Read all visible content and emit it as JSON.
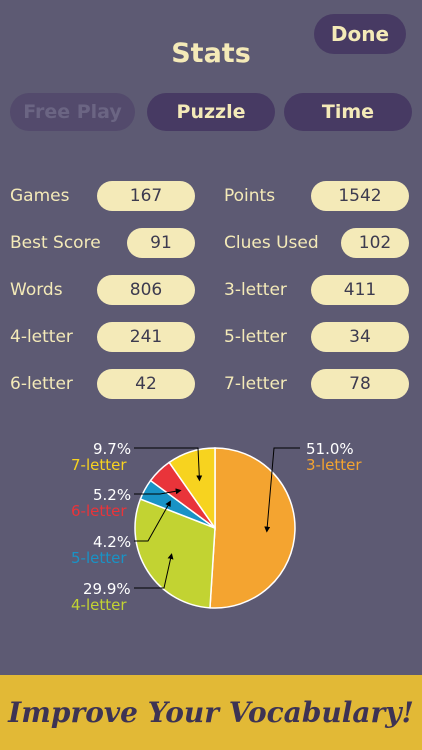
{
  "header": {
    "title": "Stats",
    "done_label": "Done"
  },
  "tabs": [
    {
      "label": "Free Play",
      "enabled": false
    },
    {
      "label": "Puzzle",
      "enabled": true
    },
    {
      "label": "Time",
      "enabled": true
    }
  ],
  "stats": {
    "games": {
      "label": "Games",
      "value": "167"
    },
    "points": {
      "label": "Points",
      "value": "1542"
    },
    "best_score": {
      "label": "Best Score",
      "value": "91"
    },
    "clues_used": {
      "label": "Clues Used",
      "value": "102"
    },
    "words": {
      "label": "Words",
      "value": "806"
    },
    "three_letter": {
      "label": "3-letter",
      "value": "411"
    },
    "four_letter": {
      "label": "4-letter",
      "value": "241"
    },
    "five_letter": {
      "label": "5-letter",
      "value": "34"
    },
    "six_letter": {
      "label": "6-letter",
      "value": "42"
    },
    "seven_letter": {
      "label": "7-letter",
      "value": "78"
    }
  },
  "chart_data": {
    "type": "pie",
    "slices": [
      {
        "label": "3-letter",
        "percent": "51.0%",
        "value": 51.0,
        "color": "#f4a430"
      },
      {
        "label": "4-letter",
        "percent": "29.9%",
        "value": 29.9,
        "color": "#c2d332"
      },
      {
        "label": "5-letter",
        "percent": "4.2%",
        "value": 4.2,
        "color": "#1993c6"
      },
      {
        "label": "6-letter",
        "percent": "5.2%",
        "value": 5.2,
        "color": "#e9343a"
      },
      {
        "label": "7-letter",
        "percent": "9.7%",
        "value": 9.7,
        "color": "#f7d31f"
      }
    ]
  },
  "banner": {
    "text": "Improve Your Vocabulary!"
  },
  "colors": {
    "background": "#5d5a73",
    "cream": "#f4eab8",
    "button": "#473a63",
    "banner": "#e2b936"
  }
}
